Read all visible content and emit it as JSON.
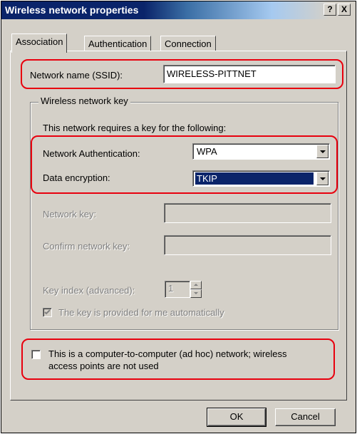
{
  "window": {
    "title": "Wireless network properties",
    "help_label": "?",
    "close_label": "X"
  },
  "tabs": [
    {
      "label": "Association"
    },
    {
      "label": "Authentication"
    },
    {
      "label": "Connection"
    }
  ],
  "association": {
    "ssid_label": "Network name (SSID):",
    "ssid_value": "WIRELESS-PITTNET",
    "group_title": "Wireless network key",
    "requires_key_text": "This network requires a key for the following:",
    "auth_label": "Network Authentication:",
    "auth_value": "WPA",
    "encryption_label": "Data encryption:",
    "encryption_value": "TKIP",
    "network_key_label": "Network key:",
    "confirm_key_label": "Confirm network key:",
    "key_index_label": "Key index (advanced):",
    "key_index_value": "1",
    "auto_key_label": "The key is provided for me automatically",
    "auto_key_checked": true,
    "adhoc_label_line1": "This is a computer-to-computer (ad hoc) network; wireless",
    "adhoc_label_line2": "access points are not used",
    "adhoc_checked": false
  },
  "buttons": {
    "ok": "OK",
    "cancel": "Cancel"
  },
  "colors": {
    "titlebar": "#0a246a",
    "highlight_ring": "#e8000e",
    "face": "#d4d0c8",
    "selection": "#0a246a"
  }
}
